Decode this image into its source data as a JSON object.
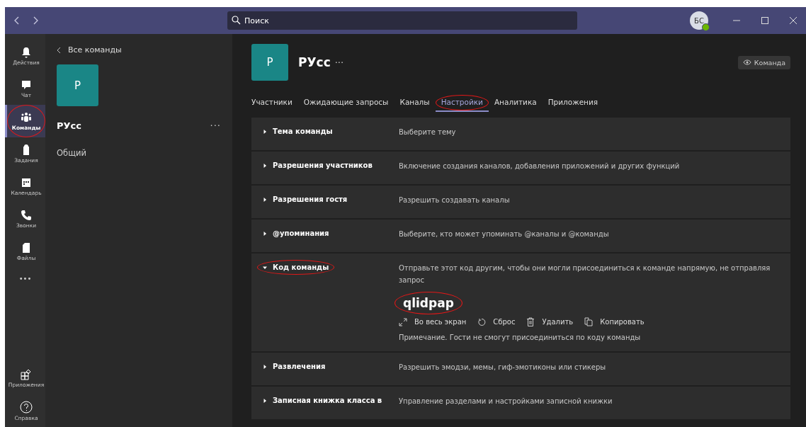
{
  "topbar": {
    "search": {
      "placeholder": "Поиск"
    },
    "avatar": "БС"
  },
  "rail": [
    {
      "label": "Действия",
      "selected": false,
      "circled": false
    },
    {
      "label": "Чат",
      "selected": false,
      "circled": false
    },
    {
      "label": "Команды",
      "selected": true,
      "circled": true
    },
    {
      "label": "Задания",
      "selected": false,
      "circled": false
    },
    {
      "label": "Календарь",
      "selected": false,
      "circled": false
    },
    {
      "label": "Звонки",
      "selected": false,
      "circled": false
    },
    {
      "label": "Файлы",
      "selected": false,
      "circled": false
    }
  ],
  "rail_more": "•••",
  "rail_bottom": [
    {
      "label": "Приложения"
    },
    {
      "label": "Справка"
    }
  ],
  "teams_panel": {
    "back": "Все команды",
    "team_tile": "Р",
    "team_name": "РУсс",
    "more": "···",
    "channels": [
      "Общий"
    ]
  },
  "header": {
    "tile": "Р",
    "title": "РУсс",
    "more": "···",
    "view_button": "Команда"
  },
  "tabs": [
    {
      "label": "Участники",
      "selected": false,
      "circled": false
    },
    {
      "label": "Ожидающие запросы",
      "selected": false,
      "circled": false
    },
    {
      "label": "Каналы",
      "selected": false,
      "circled": false
    },
    {
      "label": "Настройки",
      "selected": true,
      "circled": true
    },
    {
      "label": "Аналитика",
      "selected": false,
      "circled": false
    },
    {
      "label": "Приложения",
      "selected": false,
      "circled": false
    }
  ],
  "settings": [
    {
      "title": "Тема команды",
      "description": "Выберите тему",
      "expanded": false,
      "circled": false
    },
    {
      "title": "Разрешения участников",
      "description": "Включение создания каналов, добавления приложений и других функций",
      "expanded": false,
      "circled": false
    },
    {
      "title": "Разрешения гостя",
      "description": "Разрешить создавать каналы",
      "expanded": false,
      "circled": false
    },
    {
      "title": "@упоминания",
      "description": "Выберите, кто может упоминать @каналы и @команды",
      "expanded": false,
      "circled": false
    },
    {
      "title": "Код команды",
      "description": "Отправьте этот код другим, чтобы они могли присоединиться к команде напрямую, не отправляя запрос",
      "expanded": true,
      "circled": true,
      "code": "qlidpap",
      "code_circled": true,
      "actions": [
        {
          "label": "Во весь экран"
        },
        {
          "label": "Сброс"
        },
        {
          "label": "Удалить"
        },
        {
          "label": "Копировать"
        }
      ],
      "note": "Примечание. Гости не смогут присоединиться по коду команды"
    },
    {
      "title": "Развлечения",
      "description": "Разрешить эмодзи, мемы, гиф-эмотиконы или стикеры",
      "expanded": false,
      "circled": false
    },
    {
      "title": "Записная книжка класса в",
      "description": "Управление разделами и настройками записной книжки",
      "expanded": false,
      "circled": false
    }
  ]
}
